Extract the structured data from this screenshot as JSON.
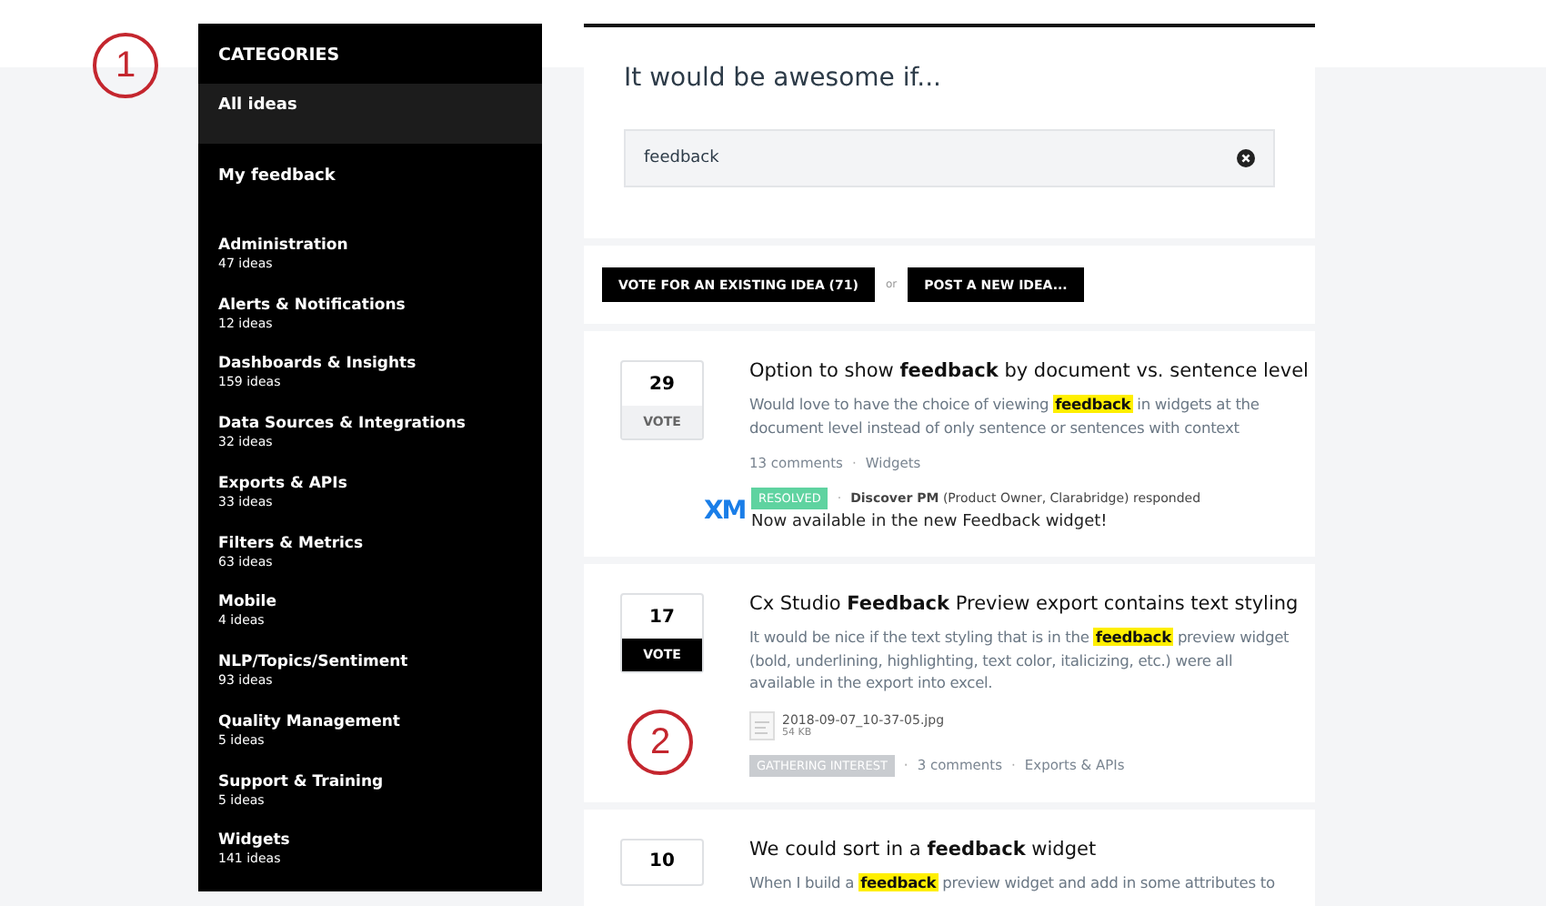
{
  "annotations": [
    {
      "label": "1"
    },
    {
      "label": "2"
    }
  ],
  "sidebar": {
    "heading": "CATEGORIES",
    "links": [
      {
        "label": "All ideas",
        "selected": true
      },
      {
        "label": "My feedback",
        "selected": false
      }
    ],
    "categories": [
      {
        "name": "Administration",
        "count": "47 ideas"
      },
      {
        "name": "Alerts & Notifications",
        "count": "12 ideas"
      },
      {
        "name": "Dashboards & Insights",
        "count": "159 ideas"
      },
      {
        "name": "Data Sources & Integrations",
        "count": "32 ideas"
      },
      {
        "name": "Exports & APIs",
        "count": "33 ideas"
      },
      {
        "name": "Filters & Metrics",
        "count": "63 ideas"
      },
      {
        "name": "Mobile",
        "count": "4 ideas"
      },
      {
        "name": "NLP/Topics/Sentiment",
        "count": "93 ideas"
      },
      {
        "name": "Quality Management",
        "count": "5 ideas"
      },
      {
        "name": "Support & Training",
        "count": "5 ideas"
      },
      {
        "name": "Widgets",
        "count": "141 ideas"
      }
    ]
  },
  "search": {
    "heading": "It would be awesome if...",
    "value": "feedback"
  },
  "actions": {
    "vote_button": "VOTE FOR AN EXISTING IDEA (71)",
    "separator": "or",
    "post_button": "POST A NEW IDEA..."
  },
  "ideas": [
    {
      "separator": "·",
      "votes": "29",
      "vote_label": "VOTE",
      "voted": false,
      "title": "Option to show **feedback** by document vs. sentence level",
      "description": {
        "before": "Would love to have the choice of viewing",
        "highlight": "feedback",
        "after": "in widgets at the document level instead of only sentence or sentences with context"
      },
      "meta": [
        "13 comments",
        "Widgets"
      ],
      "response": {
        "logo": "XM",
        "status": {
          "label": "RESOLVED",
          "color": "#5fd3a0"
        },
        "responder": "Discover PM",
        "role": "(Product Owner, Clarabridge) responded",
        "message": "Now available in the new Feedback widget!"
      }
    },
    {
      "separator": "·",
      "votes": "17",
      "vote_label": "VOTE",
      "voted": true,
      "title": "Cx Studio **Feedback** Preview export contains text styling",
      "description": {
        "before": "It would be nice if the text styling that is in the",
        "highlight": "feedback",
        "after": "preview widget (bold, underlining, highlighting, text color, italicizing, etc.) were all available in the export into excel."
      },
      "attachment": {
        "name": "2018-09-07_10-37-05.jpg",
        "size": "54 KB"
      },
      "status": {
        "label": "GATHERING INTEREST",
        "color": "#c9ccd0"
      },
      "meta": [
        "3 comments",
        "Exports & APIs"
      ]
    },
    {
      "votes": "10",
      "title": "We could sort in a **feedback** widget",
      "description": {
        "before": "When I build a",
        "highlight": "feedback",
        "after": "preview widget and add in some attributes to"
      }
    }
  ]
}
